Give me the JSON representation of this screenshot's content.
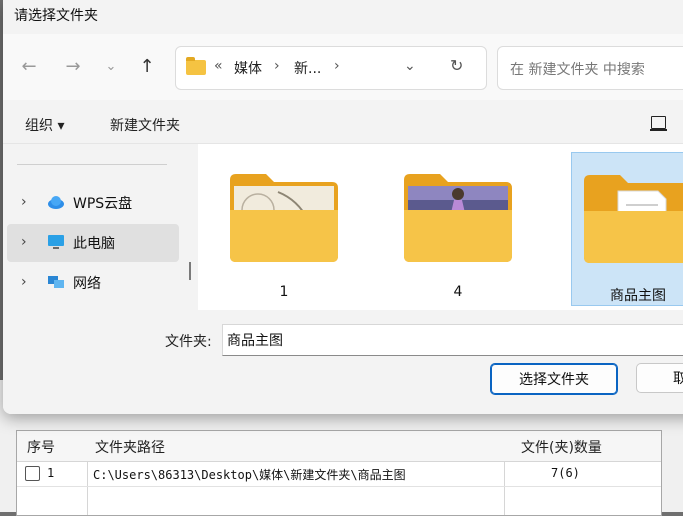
{
  "dialog": {
    "title": "请选择文件夹",
    "nav": {
      "back_icon": "arrow-left-icon",
      "forward_icon": "arrow-right-icon",
      "recent_icon": "chevron-down-icon",
      "up_icon": "arrow-up-icon"
    },
    "address": {
      "overflow": "«",
      "crumbs": [
        "媒体",
        "新..."
      ],
      "separator": "›"
    },
    "search": {
      "placeholder": "在 新建文件夹 中搜索"
    },
    "commands": {
      "organize": "组织 ▾",
      "new_folder": "新建文件夹"
    },
    "sidebar": [
      {
        "label": "WPS云盘",
        "icon": "cloud-icon"
      },
      {
        "label": "此电脑",
        "icon": "computer-icon",
        "selected": true
      },
      {
        "label": "网络",
        "icon": "network-icon"
      }
    ],
    "files": [
      {
        "label": "1",
        "icon": "folder-icon"
      },
      {
        "label": "4",
        "icon": "folder-icon"
      },
      {
        "label": "商品主图",
        "icon": "folder-icon",
        "selected": true
      }
    ],
    "folder_label": "文件夹:",
    "folder_value": "商品主图",
    "select_button": "选择文件夹",
    "cancel_button": "取"
  },
  "background": {
    "table": {
      "headers": [
        "序号",
        "文件夹路径",
        "文件(夹)数量"
      ],
      "rows": [
        {
          "index": "1",
          "path": "C:\\Users\\86313\\Desktop\\媒体\\新建文件夹\\商品主图",
          "count": "7(6)"
        }
      ]
    }
  }
}
